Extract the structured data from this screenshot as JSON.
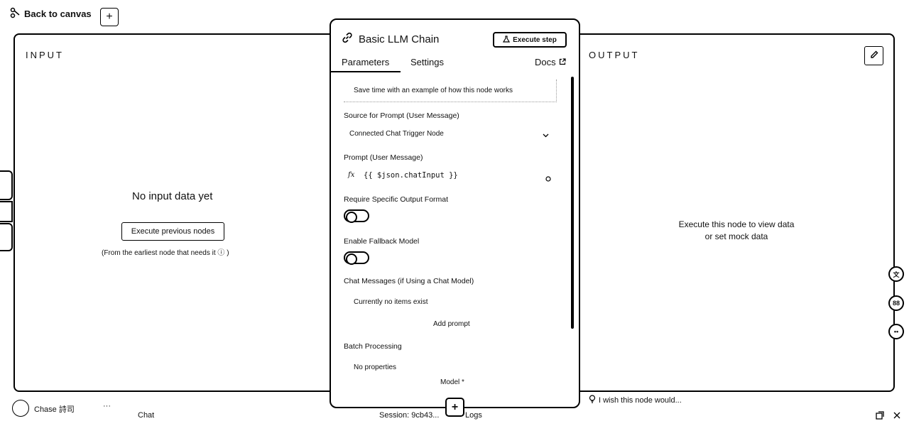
{
  "header": {
    "back_label": "Back to canvas",
    "add_label": "+"
  },
  "input_panel": {
    "title": "INPUT",
    "empty_title": "No input data yet",
    "execute_prev_label": "Execute previous nodes",
    "hint": "(From the earliest node that needs it ⓘ )"
  },
  "output_panel": {
    "title": "OUTPUT",
    "message_line1": "Execute this node to view data",
    "message_line2": "or set mock data"
  },
  "node": {
    "title": "Basic LLM Chain",
    "execute_step_label": "Execute step",
    "tabs": [
      {
        "label": "Parameters",
        "active": true
      },
      {
        "label": "Settings",
        "active": false
      }
    ],
    "docs_label": "Docs",
    "tip_text": "Save time with an example of how this node works",
    "source_label": "Source for Prompt (User Message)",
    "source_value": "Connected Chat Trigger Node",
    "prompt_label": "Prompt (User Message)",
    "prompt_fx": "fx",
    "prompt_value": "{{ $json.chatInput }}",
    "require_format_label": "Require Specific Output Format",
    "require_format_enabled": false,
    "fallback_label": "Enable Fallback Model",
    "fallback_enabled": false,
    "chat_messages_label": "Chat Messages (if Using a Chat Model)",
    "chat_messages_empty": "Currently no items exist",
    "add_prompt_label": "Add prompt",
    "batch_label": "Batch Processing",
    "batch_value": "No properties",
    "model_label": "Model *",
    "add_label": "+"
  },
  "bottom_bar": {
    "user_name": "Chase 詩司",
    "menu_label": "···",
    "chat_label": "Chat",
    "session_label": "Session: 9cb43...",
    "logs_label": "Logs",
    "feedback_label": "I wish this node would..."
  },
  "icons": {
    "back": "back-arrow-icon",
    "node": "link-icon",
    "execute": "flask-icon",
    "docs": "external-link-icon",
    "edit": "pencil-icon",
    "chevron": "chevron-down-icon"
  }
}
